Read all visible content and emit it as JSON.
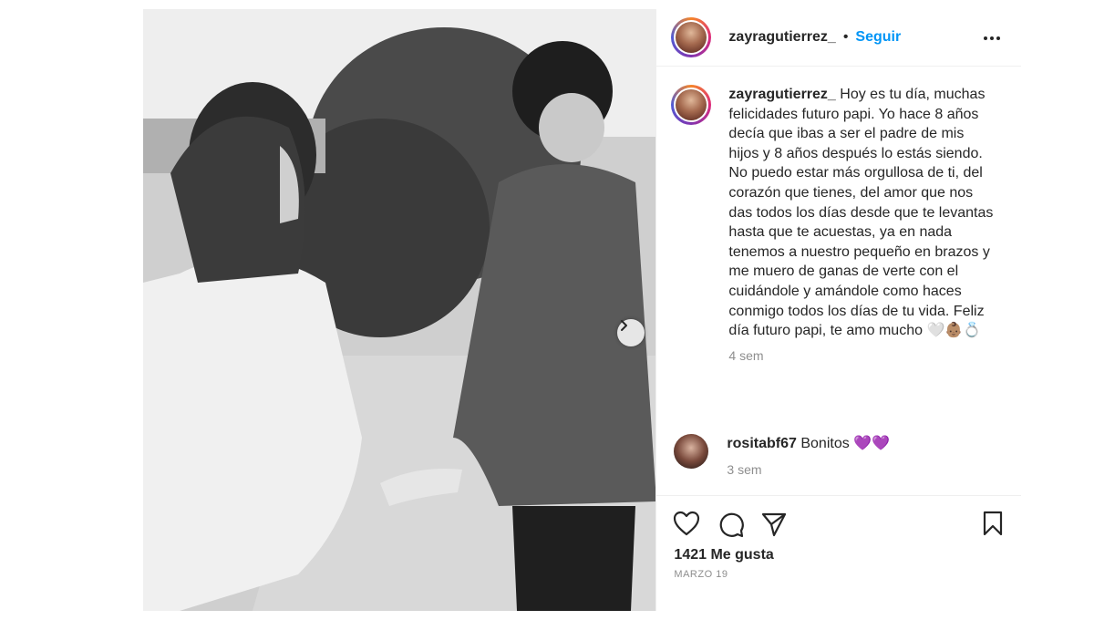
{
  "post": {
    "author": "zayragutierrez_",
    "separator": "•",
    "follow_label": "Seguir",
    "caption_author": "zayragutierrez_",
    "caption_text": "Hoy es tu día, muchas felicidades futuro papi. Yo hace 8 años decía que ibas a ser el padre de mis hijos y 8 años después lo estás siendo. No puedo estar más orgullosa de ti, del corazón que tienes, del amor que nos das todos los días desde que te levantas hasta que te acuestas, ya en nada tenemos a nuestro pequeño en brazos y me muero de ganas de verte con el cuidándole y amándole como haces conmigo todos los días de tu vida. Feliz día futuro papi, te amo mucho 🤍👶🏽💍",
    "caption_time": "4 sem",
    "likes": "1421 Me gusta",
    "date": "MARZO 19"
  },
  "comments": [
    {
      "user": "rositabf67",
      "text": "Bonitos 💜💜",
      "time": "3 sem"
    }
  ],
  "icons": {
    "more": "more-options-icon",
    "like": "heart-icon",
    "comment": "comment-icon",
    "share": "paper-plane-icon",
    "save": "bookmark-icon",
    "next": "chevron-right-icon"
  },
  "colors": {
    "accent": "#0095f6",
    "text": "#262626",
    "muted": "#8e8e8e"
  }
}
